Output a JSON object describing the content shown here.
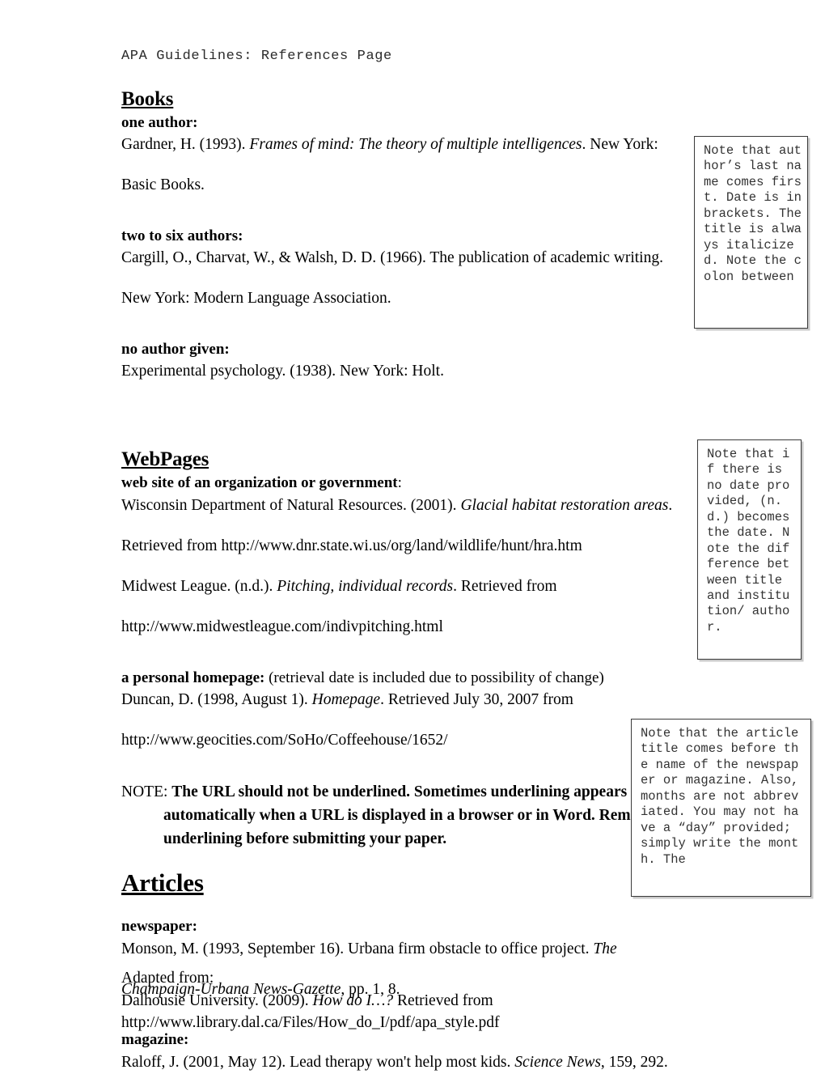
{
  "document": {
    "running_header": "APA Guidelines: References Page"
  },
  "sections": {
    "books": {
      "heading": "Books",
      "one_author_label": "one author:",
      "one_author_line1_pre": "Gardner, H. (1993). ",
      "one_author_line1_italic": "Frames of mind: The theory of multiple intelligences",
      "one_author_line1_post": ". New York:",
      "one_author_line2": "Basic Books.",
      "two_six_label": "two to six authors:",
      "two_six_line1": "Cargill, O., Charvat, W., & Walsh, D. D. (1966). The publication of academic writing.",
      "two_six_line2": "New York: Modern Language Association.",
      "no_author_label": "no author given:",
      "no_author_line1": "Experimental psychology. (1938). New York: Holt."
    },
    "webpages": {
      "heading": "WebPages",
      "org_label": "web site of an organization or government",
      "org_label_colon": ":",
      "org_line1_pre": "Wisconsin Department of Natural Resources. (2001). ",
      "org_line1_italic": "Glacial habitat restoration areas",
      "org_line1_post": ".",
      "org_line2": "Retrieved from http://www.dnr.state.wi.us/org/land/wildlife/hunt/hra.htm",
      "midwest_line1_pre": "Midwest League. (n.d.). ",
      "midwest_line1_italic": "Pitching, individual records",
      "midwest_line1_post": ". Retrieved from",
      "midwest_line2": "http://www.midwestleague.com/indivpitching.html",
      "homepage_label": "a personal homepage:",
      "homepage_label_rest": " (retrieval date is included due to possibility of change)",
      "homepage_line1_pre": "Duncan, D. (1998, August 1). ",
      "homepage_line1_italic": "Homepage",
      "homepage_line1_post": ". Retrieved July 30, 2007 from",
      "homepage_line2": "http://www.geocities.com/SoHo/Coffeehouse/1652/"
    },
    "url_note": {
      "lead": "NOTE: ",
      "body": "The URL should not be underlined. Sometimes underlining appears automatically when a URL is displayed in a browser or in Word. Remove the underlining before submitting your paper."
    },
    "articles": {
      "heading": "Articles",
      "newspaper_label": "newspaper:",
      "newspaper_line1_pre": "Monson, M. (1993, September 16). Urbana firm obstacle to office project. ",
      "newspaper_line1_italic": "The",
      "newspaper_line2_italic": "Champaign-Urbana News-Gazette",
      "newspaper_line2_post": ", pp. 1, 8.",
      "magazine_label": "magazine:",
      "magazine_line1_pre": "Raloff, J. (2001, May 12). Lead therapy won't help most kids. ",
      "magazine_line1_italic": "Science News",
      "magazine_line1_post": ", 159, 292."
    }
  },
  "callouts": [
    {
      "id": "callout-1",
      "text": "Note that author’s last name comes first. Date is in brackets. The title is always italicized. Note the colon between"
    },
    {
      "id": "callout-2",
      "text": "Note that if there is no date provided, (n.d.) becomes the date. Note the difference between title and institution/ author."
    },
    {
      "id": "callout-3",
      "text": "Note that the article title comes before the name of the newspaper or magazine. Also, months are not abbreviated. You may not have a “day” provided; simply write the month. The"
    }
  ],
  "credit": {
    "line1": "Adapted from:",
    "line2_pre": "Dalhousie University. (2009). ",
    "line2_italic": "How do I…?",
    "line2_post": " Retrieved from",
    "line3": "http://www.library.dal.ca/Files/How_do_I/pdf/apa_style.pdf"
  }
}
